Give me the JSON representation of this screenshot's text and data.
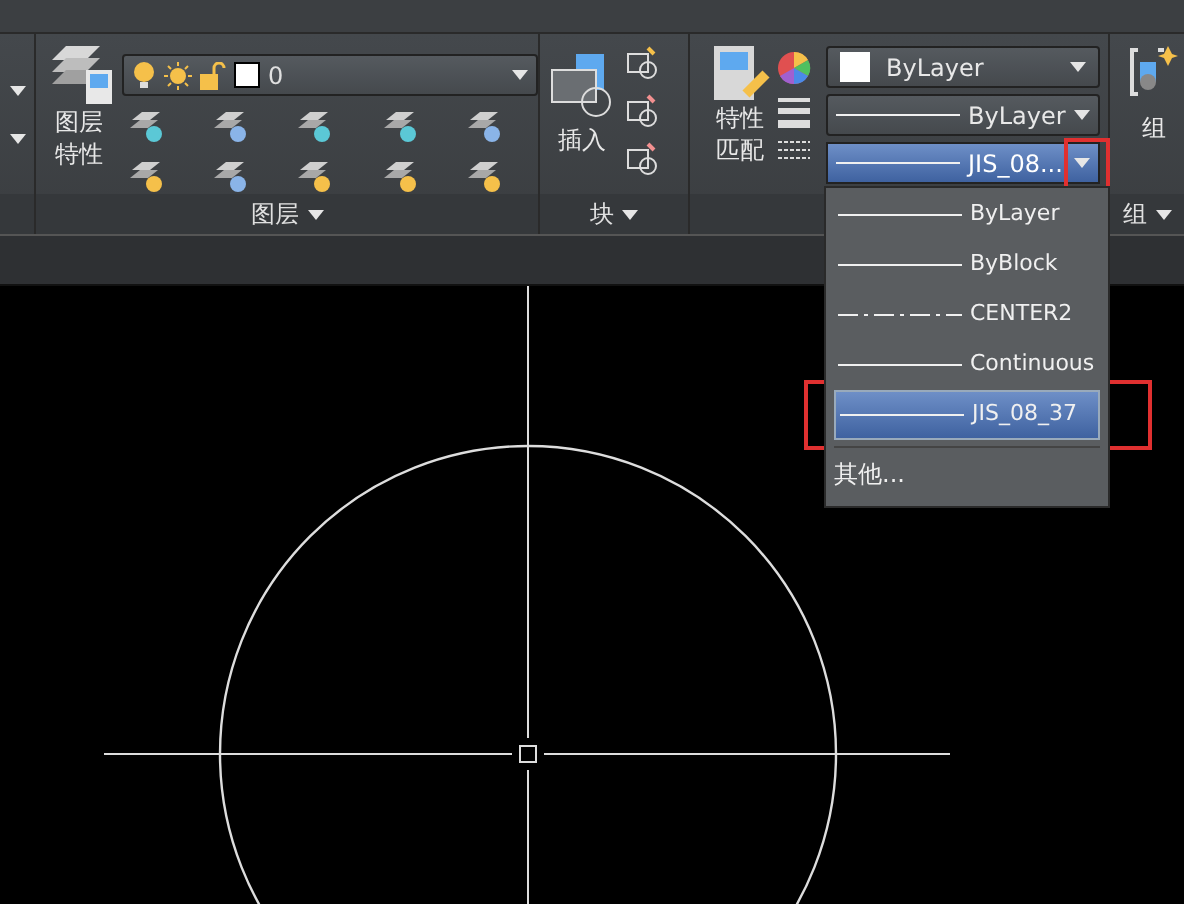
{
  "layer_panel": {
    "properties_button": [
      "图层",
      "特性"
    ],
    "layer_combo": {
      "value": "0"
    },
    "footer": "图层"
  },
  "block_panel": {
    "insert_button": "插入",
    "footer": "块"
  },
  "properties_panel": {
    "match_button": [
      "特性",
      "匹配"
    ],
    "color_combo": {
      "value": "ByLayer"
    },
    "lineweight_combo": {
      "value": "ByLayer"
    },
    "linetype_combo": {
      "value": "JIS_08..."
    },
    "linetype_list": [
      {
        "label": "ByLayer",
        "kind": "solid",
        "selected": false
      },
      {
        "label": "ByBlock",
        "kind": "solid",
        "selected": false
      },
      {
        "label": "CENTER2",
        "kind": "dashdot",
        "selected": false
      },
      {
        "label": "Continuous",
        "kind": "solid",
        "selected": false
      },
      {
        "label": "JIS_08_37",
        "kind": "solid",
        "selected": true
      }
    ],
    "other_item": "其他..."
  },
  "group_panel": {
    "group_button": "组",
    "footer": "组"
  }
}
